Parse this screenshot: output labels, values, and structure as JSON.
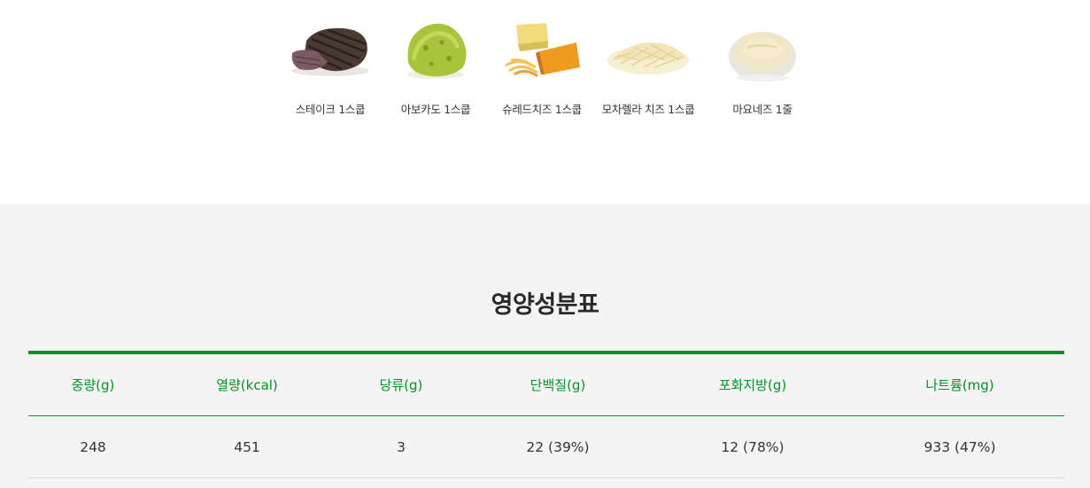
{
  "toppings": [
    {
      "label": "스테이크 1스쿱",
      "icon": "steak-icon"
    },
    {
      "label": "아보카도 1스쿱",
      "icon": "avocado-icon"
    },
    {
      "label": "슈레드치즈 1스쿱",
      "icon": "shredded-cheese-icon"
    },
    {
      "label": "모차렐라 치즈 1스쿱",
      "icon": "mozzarella-cheese-icon"
    },
    {
      "label": "마요네즈 1줄",
      "icon": "mayonnaise-icon"
    }
  ],
  "nutrition": {
    "title": "영양성분표",
    "headers": [
      "중량(g)",
      "열량(kcal)",
      "당류(g)",
      "단백질(g)",
      "포화지방(g)",
      "나트륨(mg)"
    ],
    "values": [
      "248",
      "451",
      "3",
      "22 (39%)",
      "12 (78%)",
      "933 (47%)"
    ]
  },
  "colors": {
    "accent": "#009223",
    "section_bg": "#f4f4f4"
  }
}
